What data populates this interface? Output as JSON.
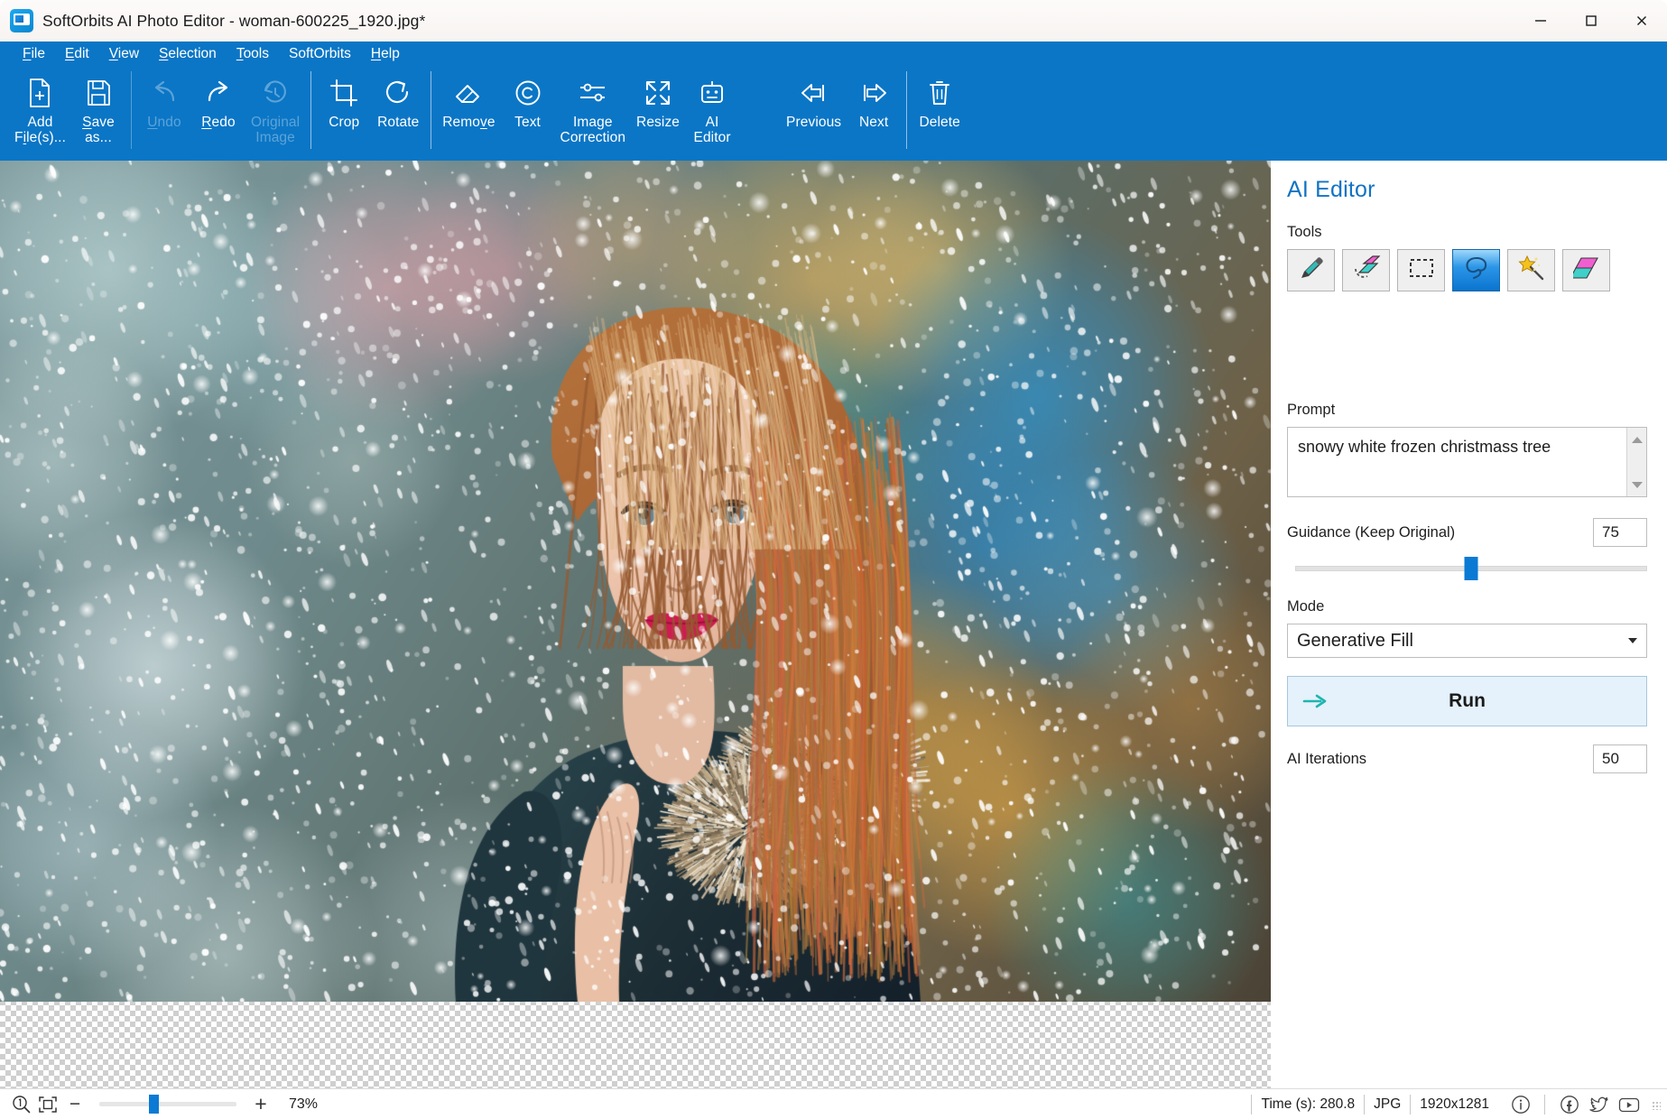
{
  "window": {
    "title": "SoftOrbits AI Photo Editor - woman-600225_1920.jpg*",
    "app_icon": "app-logo-icon",
    "minimize_label": "Minimize",
    "maximize_label": "Maximize",
    "close_label": "Close"
  },
  "menu": {
    "items": [
      {
        "label": "File",
        "accel": "F"
      },
      {
        "label": "Edit",
        "accel": "E"
      },
      {
        "label": "View",
        "accel": "V"
      },
      {
        "label": "Selection",
        "accel": "S"
      },
      {
        "label": "Tools",
        "accel": "T"
      },
      {
        "label": "SoftOrbits",
        "accel": ""
      },
      {
        "label": "Help",
        "accel": "H"
      }
    ]
  },
  "toolbar": {
    "buttons": [
      {
        "name": "add-files",
        "label": "Add\nFile(s)...",
        "icon": "file-plus-icon",
        "enabled": true
      },
      {
        "name": "save-as",
        "label": "Save\nas...",
        "icon": "floppy-disk-icon",
        "enabled": true
      },
      {
        "name": "undo",
        "label": "Undo",
        "icon": "undo-arrow-icon",
        "enabled": false
      },
      {
        "name": "redo",
        "label": "Redo",
        "icon": "redo-arrow-icon",
        "enabled": true
      },
      {
        "name": "original-image",
        "label": "Original\nImage",
        "icon": "clock-history-icon",
        "enabled": false
      },
      {
        "name": "crop",
        "label": "Crop",
        "icon": "crop-icon",
        "enabled": true
      },
      {
        "name": "rotate",
        "label": "Rotate",
        "icon": "rotate-cw-icon",
        "enabled": true
      },
      {
        "name": "remove",
        "label": "Remove",
        "icon": "eraser-icon",
        "enabled": true
      },
      {
        "name": "text",
        "label": "Text",
        "icon": "copyright-circle-icon",
        "enabled": true
      },
      {
        "name": "image-correction",
        "label": "Image\nCorrection",
        "icon": "sliders-icon",
        "enabled": true
      },
      {
        "name": "resize",
        "label": "Resize",
        "icon": "expand-arrows-icon",
        "enabled": true
      },
      {
        "name": "ai-editor",
        "label": "AI\nEditor",
        "icon": "robot-icon",
        "enabled": true
      },
      {
        "name": "previous",
        "label": "Previous",
        "icon": "arrow-left-icon",
        "enabled": true
      },
      {
        "name": "next",
        "label": "Next",
        "icon": "arrow-right-icon",
        "enabled": true
      },
      {
        "name": "delete",
        "label": "Delete",
        "icon": "trash-icon",
        "enabled": true
      }
    ]
  },
  "panel": {
    "title": "AI Editor",
    "tools_label": "Tools",
    "tools": [
      {
        "name": "brush-tool",
        "icon": "brush-icon",
        "active": false
      },
      {
        "name": "erase-tool",
        "icon": "eraser-circle-icon",
        "active": false
      },
      {
        "name": "rect-select-tool",
        "icon": "rectangle-select-icon",
        "active": false
      },
      {
        "name": "lasso-tool",
        "icon": "lasso-icon",
        "active": true
      },
      {
        "name": "magic-wand-tool",
        "icon": "magic-wand-icon",
        "active": false
      },
      {
        "name": "gradient-tool",
        "icon": "gradient-fill-icon",
        "active": false
      }
    ],
    "prompt_label": "Prompt",
    "prompt_value": "snowy white frozen christmass tree",
    "guidance_label": "Guidance (Keep Original)",
    "guidance_value": "75",
    "guidance_percent": 50,
    "mode_label": "Mode",
    "mode_value": "Generative Fill",
    "mode_options": [
      "Generative Fill"
    ],
    "run_label": "Run",
    "run_icon": "arrow-right-run-icon",
    "iterations_label": "AI Iterations",
    "iterations_value": "50"
  },
  "statusbar": {
    "zoom_one_to_one_icon": "magnifier-1to1-icon",
    "fit_icon": "fit-to-window-icon",
    "minus_label": "−",
    "plus_label": "+",
    "zoom_percent": "73%",
    "zoom_slider_percent": 36,
    "time_label": "Time (s): 280.8",
    "format_label": "JPG",
    "dimensions_label": "1920x1281",
    "info_icon": "info-circle-icon",
    "facebook_icon": "facebook-icon",
    "twitter_icon": "twitter-icon",
    "youtube_icon": "youtube-icon"
  },
  "colors": {
    "chrome_blue": "#0b76c6",
    "accent_blue": "#1273c4",
    "slider_blue": "#0b7ad4",
    "run_bg": "#e5f1fb"
  }
}
